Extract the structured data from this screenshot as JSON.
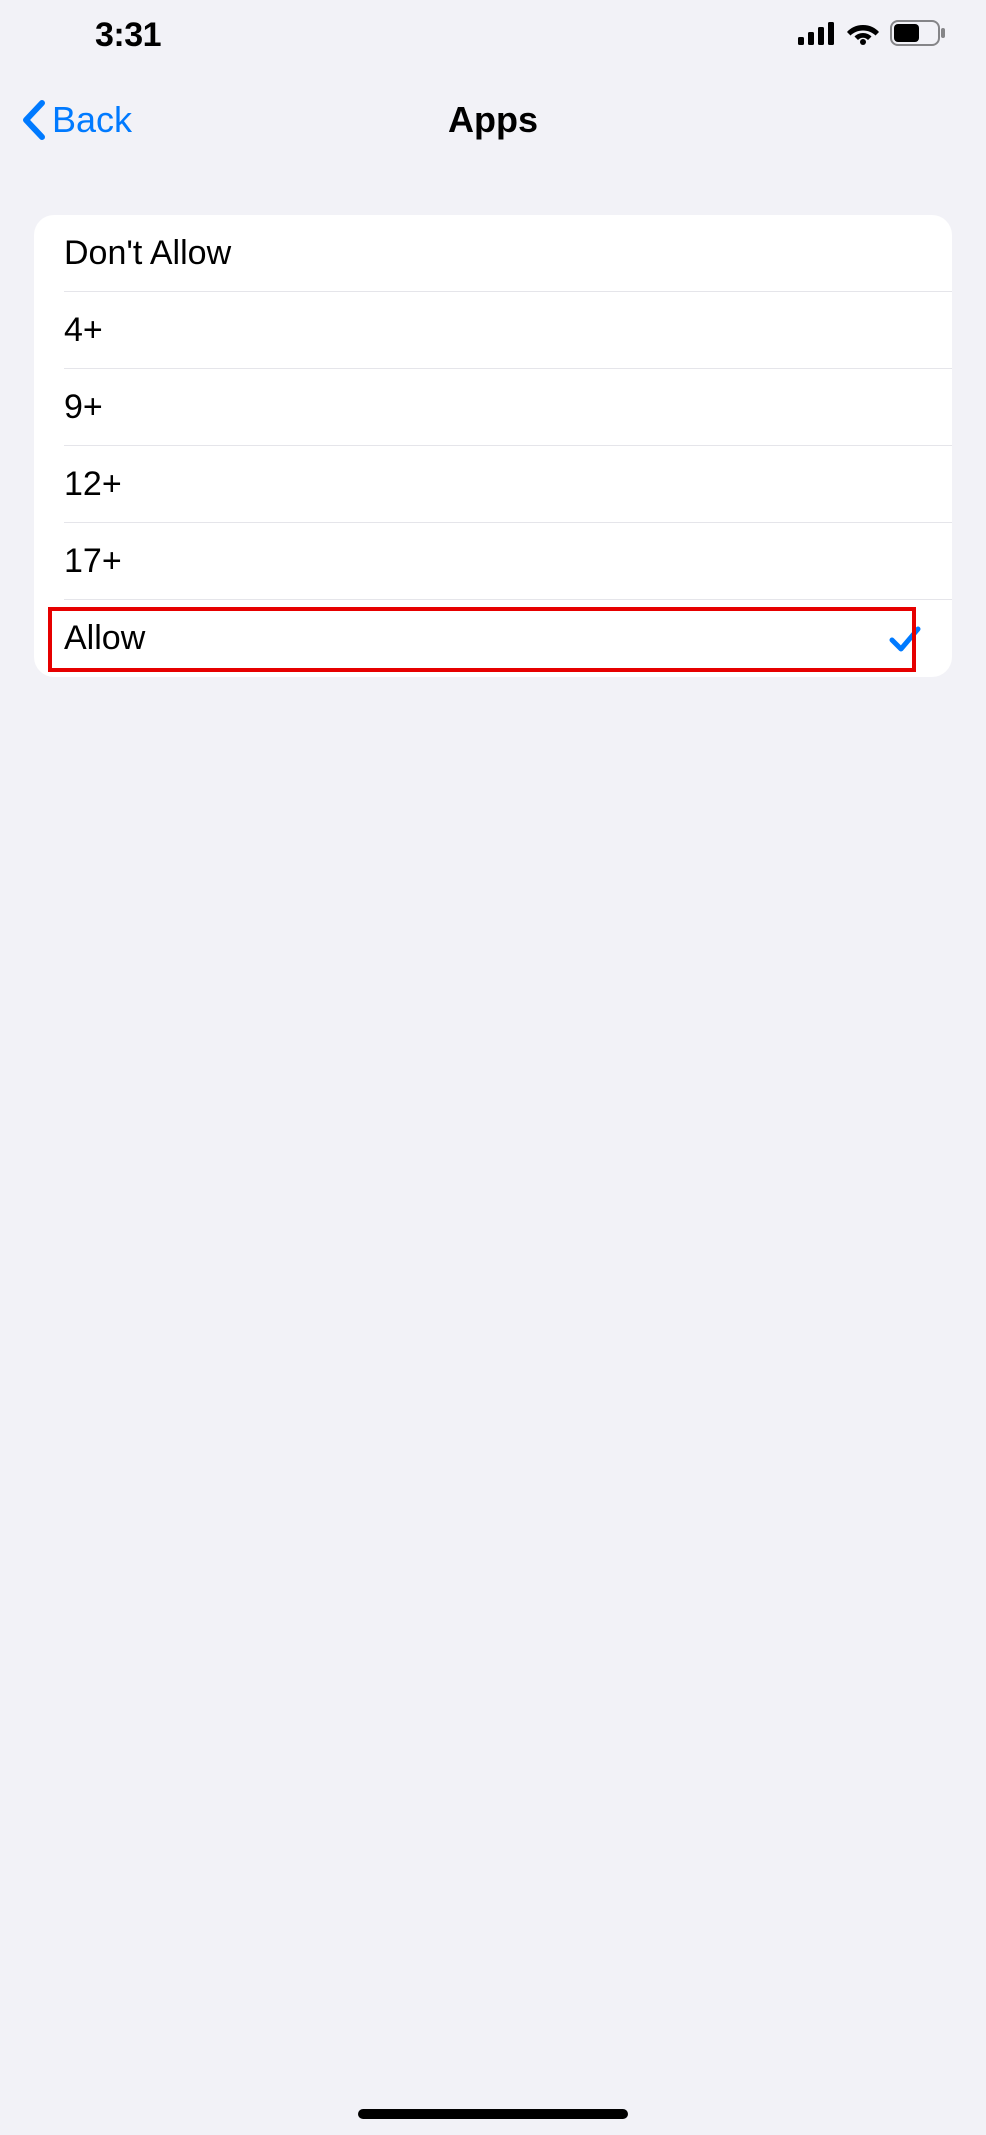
{
  "status": {
    "time": "3:31"
  },
  "nav": {
    "back_label": "Back",
    "title": "Apps"
  },
  "options": [
    {
      "label": "Don't Allow",
      "selected": false
    },
    {
      "label": "4+",
      "selected": false
    },
    {
      "label": "9+",
      "selected": false
    },
    {
      "label": "12+",
      "selected": false
    },
    {
      "label": "17+",
      "selected": false
    },
    {
      "label": "Allow",
      "selected": true
    }
  ],
  "highlighted_index": 5
}
